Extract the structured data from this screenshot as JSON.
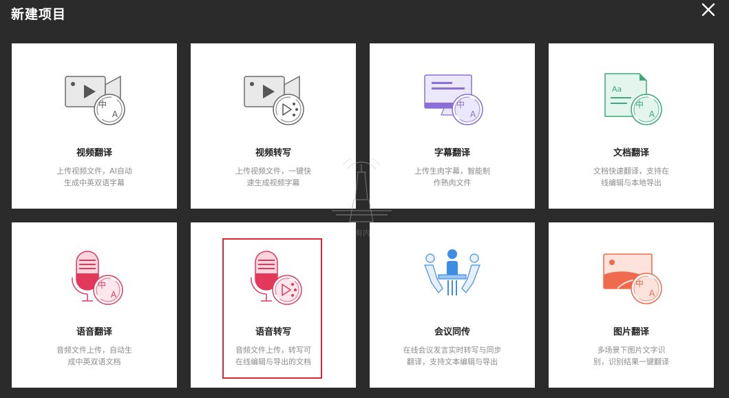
{
  "dialog": {
    "title": "新建项目",
    "close_icon": "close-icon"
  },
  "cards": [
    {
      "title": "视频翻译",
      "desc_line1": "上传视频文件，AI自动",
      "desc_line2": "生成中英双语字幕",
      "icon": "video-translate-icon"
    },
    {
      "title": "视频转写",
      "desc_line1": "上传视频文件，一键快",
      "desc_line2": "速生成视频字幕",
      "icon": "video-transcribe-icon"
    },
    {
      "title": "字幕翻译",
      "desc_line1": "上传生肉字幕，智能制",
      "desc_line2": "作熟肉文件",
      "icon": "subtitle-translate-icon"
    },
    {
      "title": "文档翻译",
      "desc_line1": "文档快速翻译，支持在",
      "desc_line2": "线编辑与本地导出",
      "icon": "document-translate-icon"
    },
    {
      "title": "语音翻译",
      "desc_line1": "音频文件上传，自动生",
      "desc_line2": "成中英双语文档",
      "icon": "audio-translate-icon"
    },
    {
      "title": "语音转写",
      "desc_line1": "音频文件上传，转写可",
      "desc_line2": "在线编辑与导出的文档",
      "icon": "audio-transcribe-icon"
    },
    {
      "title": "会议同传",
      "desc_line1": "在线会议发言实时转写与同步",
      "desc_line2": "翻译，支持文本编辑与导出",
      "icon": "meeting-interpret-icon"
    },
    {
      "title": "图片翻译",
      "desc_line1": "多场景下图片文字识",
      "desc_line2": "别，识别结果一键翻译",
      "icon": "image-translate-icon"
    }
  ],
  "icon_glyphs": {
    "zh": "中",
    "a": "A",
    "aa": "Aa"
  },
  "watermark": {
    "text": "有内"
  },
  "colors": {
    "background": "#2b2b2b",
    "card": "#ffffff",
    "highlight": "#d9282f",
    "gray_icon": "#6b6b6b",
    "purple_icon": "#8a6fd6",
    "green_icon": "#3aaa7a",
    "red_icon": "#e2395b",
    "blue_icon": "#3d8ce6",
    "orange_icon": "#f06a4e"
  }
}
